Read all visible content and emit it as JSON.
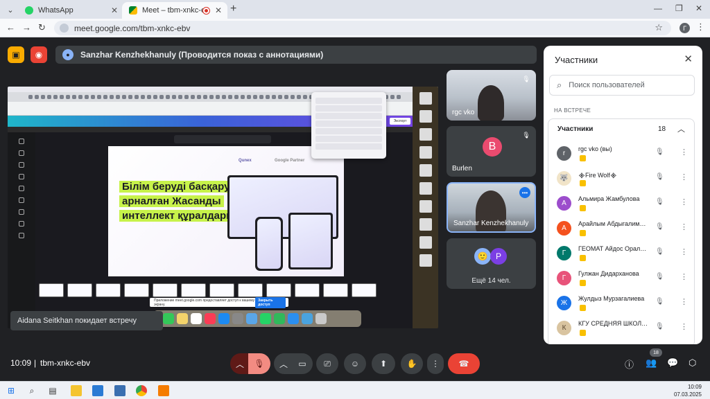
{
  "browser": {
    "tabs": [
      {
        "label": "WhatsApp",
        "close": "✕"
      },
      {
        "label": "Meet – tbm-xnkc-ebv",
        "close": "✕"
      }
    ],
    "url": "meet.google.com/tbm-xnkc-ebv",
    "profile_initial": "Г"
  },
  "meet": {
    "presenting": "Sanzhar Kenzhekhanuly (Проводится показ с аннотациями)",
    "toast": "Aidana Seitkhan покидает встречу",
    "clock": "10:09",
    "separator": "|",
    "meeting_code": "tbm-xnkc-ebv",
    "participant_count_badge": "18"
  },
  "shared_screen": {
    "slide_title": "Білім беруді басқаруға арналған Жасанды интеллект құралдары",
    "slide_logo_1": "Qunex",
    "slide_logo_2": "Google Partner",
    "share_notice": "Приложение meet.google.com предоставляет доступ к вашему экрану.",
    "share_notice_btn": "Закрыть доступ",
    "canva_share": "Экспорт"
  },
  "tiles": [
    {
      "name": "rgc vko"
    },
    {
      "name": "Burlen",
      "initial": "B"
    },
    {
      "name": "Sanzhar Kenzhekhanuly"
    },
    {
      "more_label": "Ещё 14 чел.",
      "initial": "P"
    }
  ],
  "panel": {
    "title": "Участники",
    "search_placeholder": "Поиск пользователей",
    "section_label": "НА ВСТРЕЧЕ",
    "group_title": "Участники",
    "group_count": "18",
    "participants": [
      {
        "name": "rgc vko (вы)",
        "initial": "r",
        "color": "#5f6368"
      },
      {
        "name": "᯽Fire Wolf᯽",
        "initial": "🐺",
        "color": "#f1e4c8"
      },
      {
        "name": "Альмира Жамбулова",
        "initial": "А",
        "color": "#9c4dcc"
      },
      {
        "name": "Арайлым Абдыгалимова",
        "initial": "А",
        "color": "#f4511e"
      },
      {
        "name": "ГЕОМАТ Айдос Оралбаев",
        "initial": "Г",
        "color": "#00796b"
      },
      {
        "name": "Гулжан Дидарханова",
        "initial": "Г",
        "color": "#e8537a"
      },
      {
        "name": "Жулдыз Мурзагалиева",
        "initial": "Ж",
        "color": "#1a73e8"
      },
      {
        "name": "КГУ СРЕДНЯЯ ШКОЛА №1",
        "initial": "К",
        "color": "#d9c4a0"
      }
    ]
  },
  "taskbar": {
    "time": "10:09",
    "date": "07.03.2025"
  },
  "colors": {
    "meet_bg": "#202124",
    "hangup": "#ea4335",
    "accent": "#1a73e8",
    "mic_off": "#f28b82"
  }
}
